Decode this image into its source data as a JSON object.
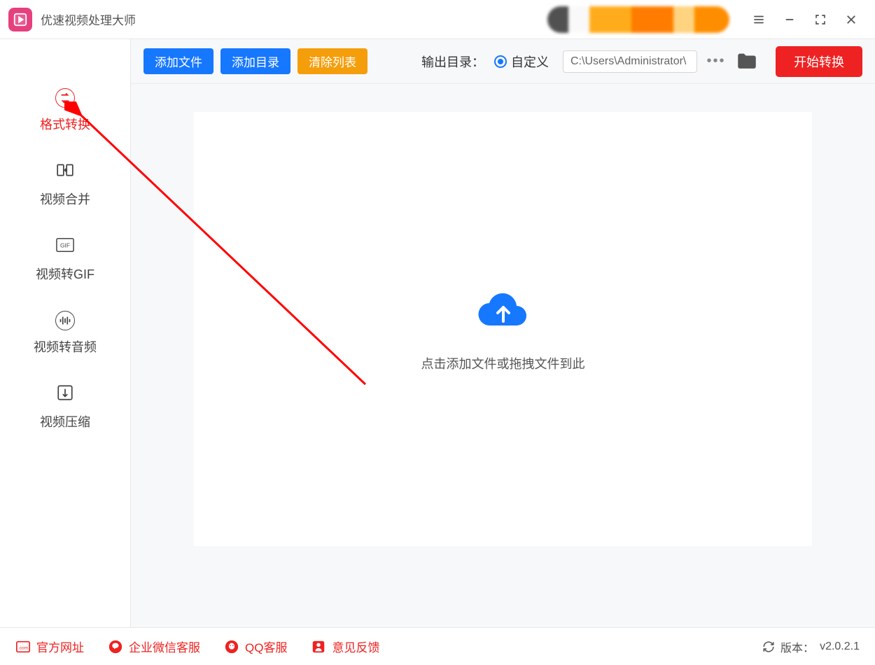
{
  "app": {
    "title": "优速视频处理大师"
  },
  "sidebar": {
    "items": [
      {
        "label": "格式转换"
      },
      {
        "label": "视频合并"
      },
      {
        "label": "视频转GIF"
      },
      {
        "label": "视频转音频"
      },
      {
        "label": "视频压缩"
      }
    ]
  },
  "toolbar": {
    "add_file": "添加文件",
    "add_folder": "添加目录",
    "clear_list": "清除列表",
    "output_label": "输出目录：",
    "custom_radio": "自定义",
    "output_path": "C:\\Users\\Administrator\\",
    "start": "开始转换"
  },
  "workspace": {
    "hint": "点击添加文件或拖拽文件到此"
  },
  "footer": {
    "official_site": "官方网址",
    "wechat_support": "企业微信客服",
    "qq_support": "QQ客服",
    "feedback": "意见反馈",
    "version_label": "版本：",
    "version": "v2.0.2.1"
  }
}
